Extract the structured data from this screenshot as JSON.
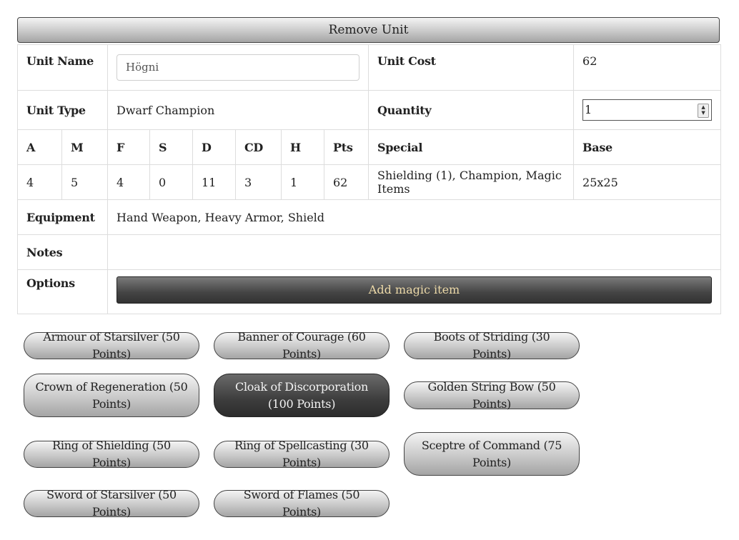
{
  "remove_button": "Remove Unit",
  "unit": {
    "name_label": "Unit Name",
    "name_value": "Högni",
    "cost_label": "Unit Cost",
    "cost_value": "62",
    "type_label": "Unit Type",
    "type_value": "Dwarf Champion",
    "quantity_label": "Quantity",
    "quantity_value": "1",
    "stat_headers": [
      "A",
      "M",
      "F",
      "S",
      "D",
      "CD",
      "H",
      "Pts"
    ],
    "stat_values": [
      "4",
      "5",
      "4",
      "0",
      "11",
      "3",
      "1",
      "62"
    ],
    "special_label": "Special",
    "special_value": "Shielding (1), Champion, Magic Items",
    "base_label": "Base",
    "base_value": "25x25",
    "equipment_label": "Equipment",
    "equipment_value": "Hand Weapon, Heavy Armor, Shield",
    "notes_label": "Notes",
    "notes_value": "",
    "options_label": "Options",
    "add_magic_item": "Add magic item"
  },
  "magic_items": [
    {
      "label": "Armour of Starsilver (50 Points)",
      "selected": false
    },
    {
      "label": "Banner of Courage (60 Points)",
      "selected": false
    },
    {
      "label": "Boots of Striding (30 Points)",
      "selected": false
    },
    {
      "label": "Crown of Regeneration (50 Points)",
      "selected": false
    },
    {
      "label": "Cloak of Discorporation (100 Points)",
      "selected": true
    },
    {
      "label": "Golden String Bow (50 Points)",
      "selected": false
    },
    {
      "label": "Ring of Shielding (50 Points)",
      "selected": false
    },
    {
      "label": "Ring of Spellcasting (30 Points)",
      "selected": false
    },
    {
      "label": "Sceptre of Command (75 Points)",
      "selected": false
    },
    {
      "label": "Sword of Starsilver (50 Points)",
      "selected": false
    },
    {
      "label": "Sword of Flames (50 Points)",
      "selected": false
    }
  ]
}
